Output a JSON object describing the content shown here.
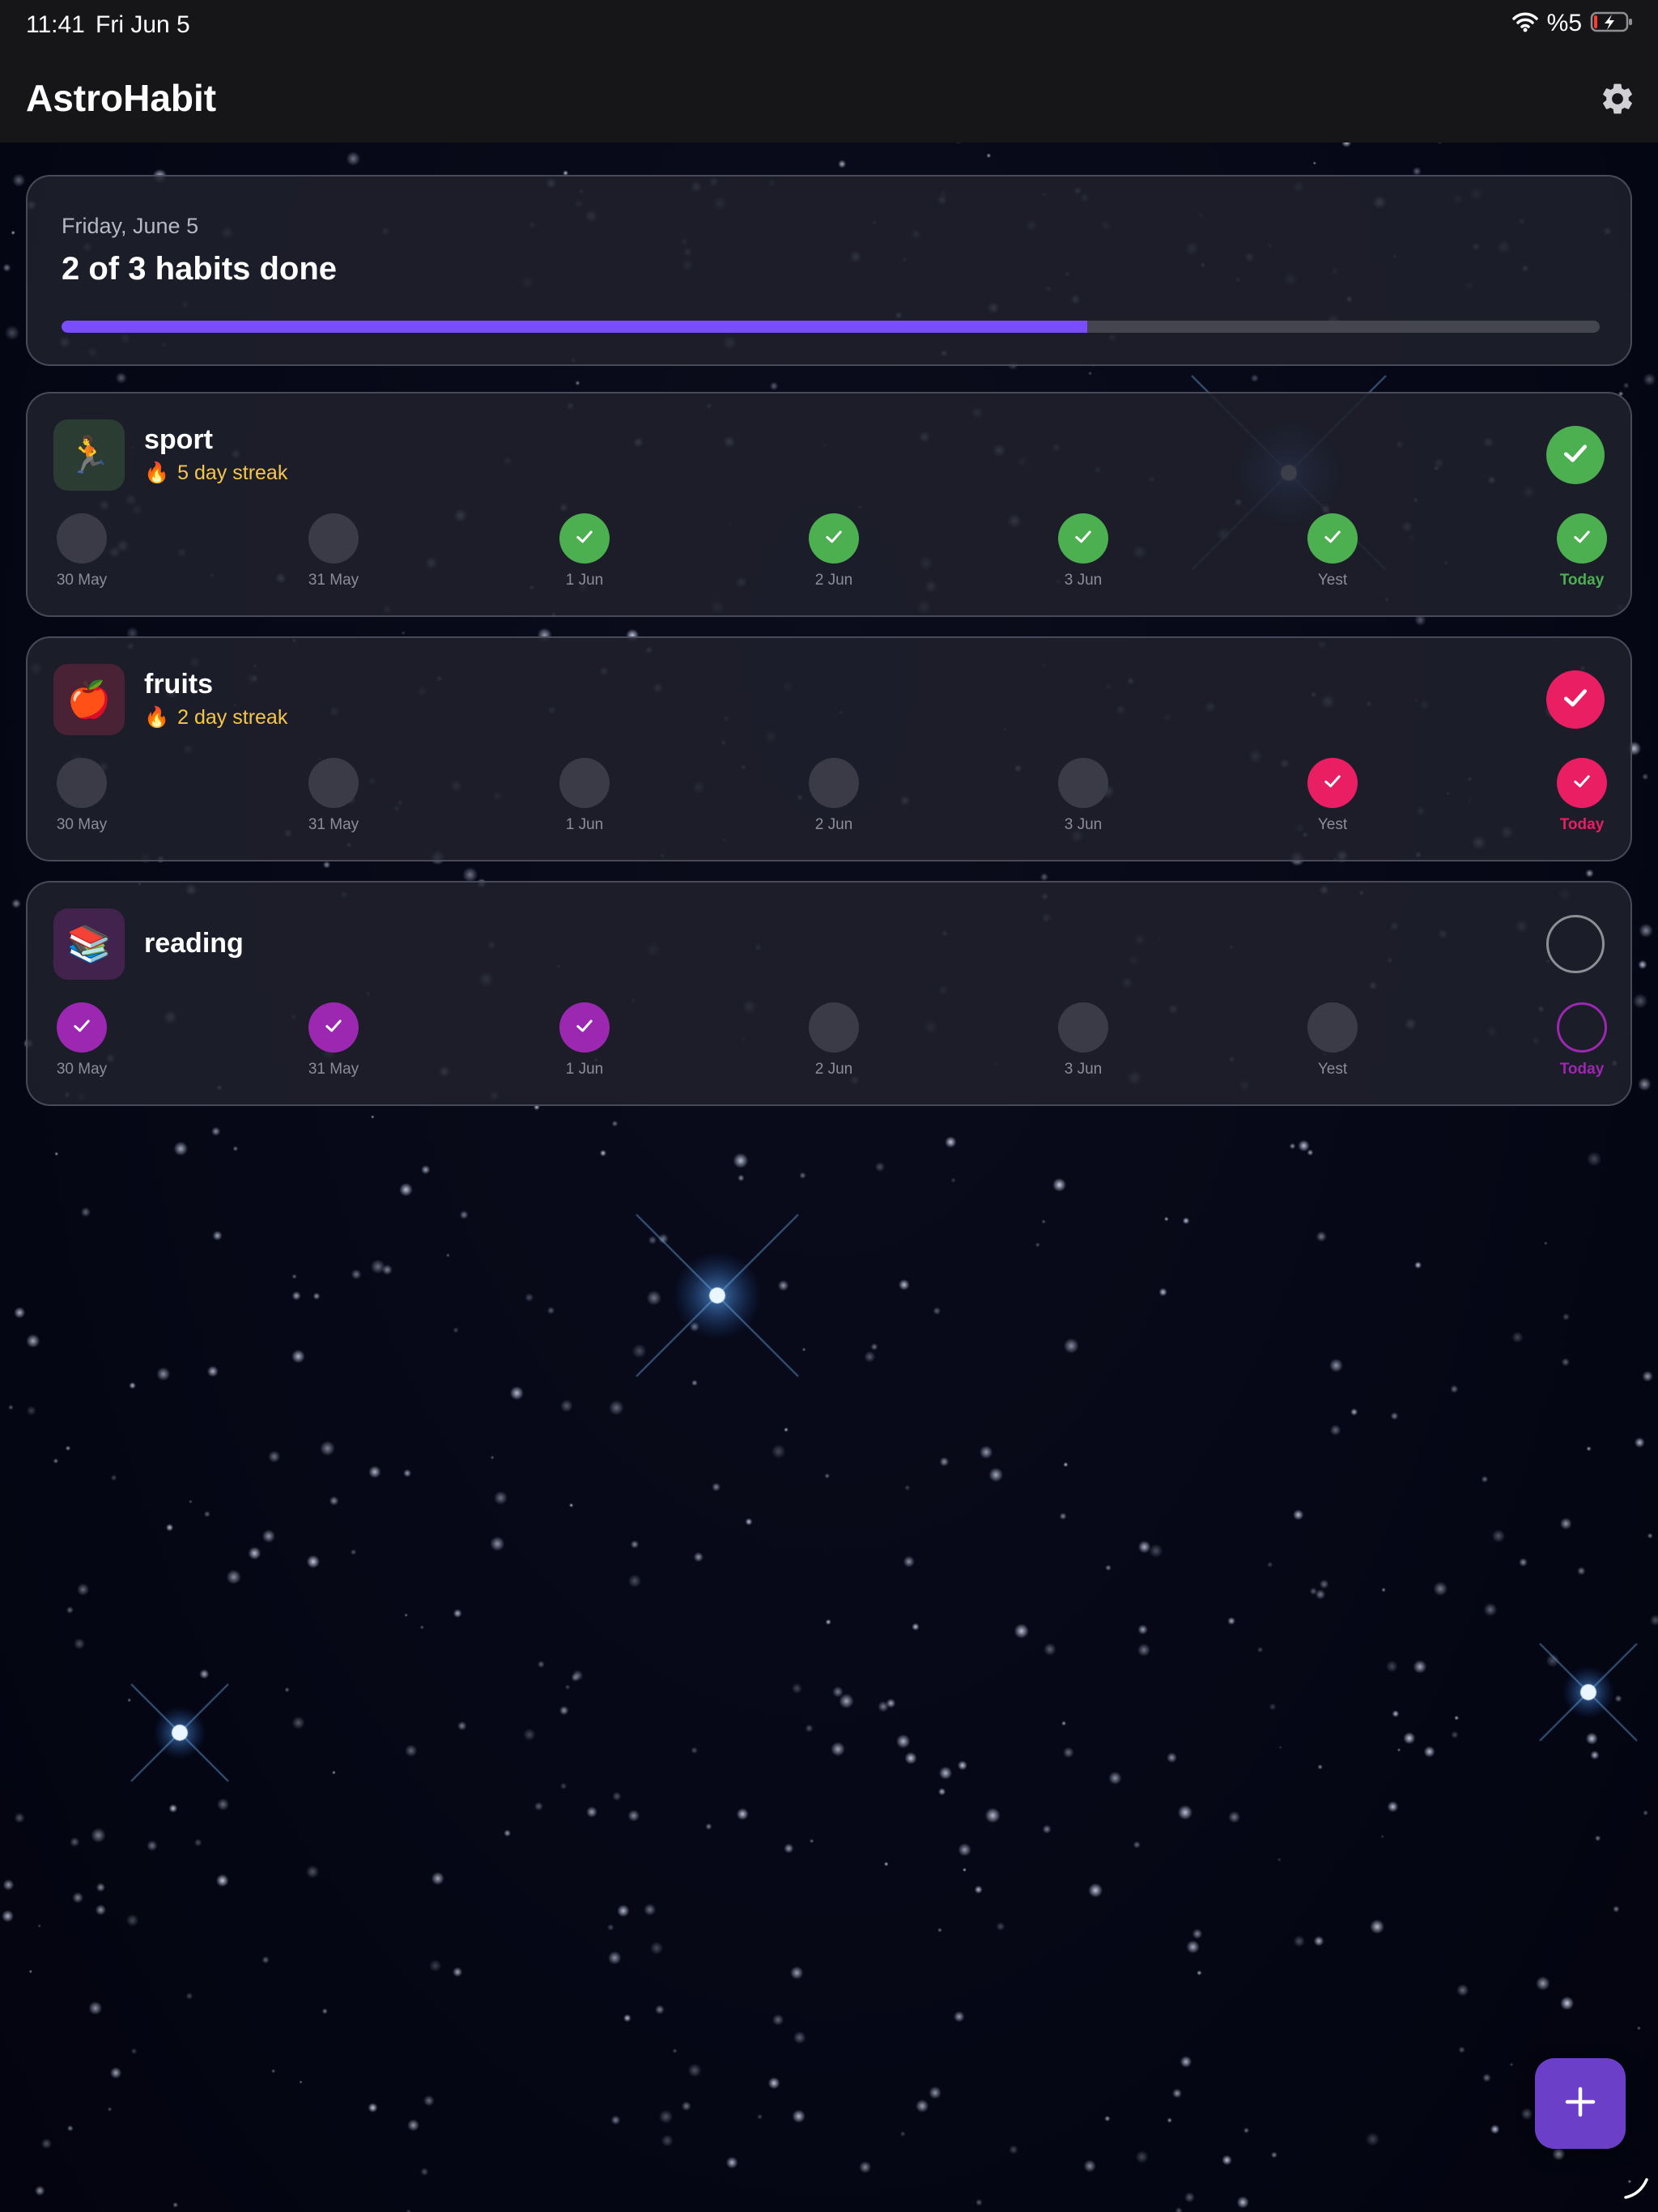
{
  "status_bar": {
    "time": "11:41",
    "date": "Fri Jun 5",
    "battery_text": "%5",
    "icons": [
      "wifi-icon",
      "battery-charging-icon"
    ]
  },
  "header": {
    "title": "AstroHabit",
    "settings_icon": "gear-icon"
  },
  "summary": {
    "date": "Friday, June 5",
    "done_text": "2 of 3 habits done",
    "progress": 0.667,
    "progress_color": "#7a4dfb"
  },
  "habits": [
    {
      "name": "sport",
      "icon": "🏃",
      "icon_bg": "#2b3c33",
      "streak": "5 day streak",
      "color": "#4caf50",
      "done_today": true,
      "days": [
        {
          "label": "30 May",
          "done": false
        },
        {
          "label": "31 May",
          "done": false
        },
        {
          "label": "1 Jun",
          "done": true
        },
        {
          "label": "2 Jun",
          "done": true
        },
        {
          "label": "3 Jun",
          "done": true
        },
        {
          "label": "Yest",
          "done": true
        },
        {
          "label": "Today",
          "done": true,
          "today": true
        }
      ]
    },
    {
      "name": "fruits",
      "icon": "🍎",
      "icon_bg": "#4a2236",
      "streak": "2 day streak",
      "color": "#e91e63",
      "done_today": true,
      "days": [
        {
          "label": "30 May",
          "done": false
        },
        {
          "label": "31 May",
          "done": false
        },
        {
          "label": "1 Jun",
          "done": false
        },
        {
          "label": "2 Jun",
          "done": false
        },
        {
          "label": "3 Jun",
          "done": false
        },
        {
          "label": "Yest",
          "done": true
        },
        {
          "label": "Today",
          "done": true,
          "today": true
        }
      ]
    },
    {
      "name": "reading",
      "icon": "📚",
      "icon_bg": "#42234e",
      "streak": "",
      "color": "#9c27b0",
      "done_today": false,
      "days": [
        {
          "label": "30 May",
          "done": true
        },
        {
          "label": "31 May",
          "done": true
        },
        {
          "label": "1 Jun",
          "done": true
        },
        {
          "label": "2 Jun",
          "done": false
        },
        {
          "label": "3 Jun",
          "done": false
        },
        {
          "label": "Yest",
          "done": false
        },
        {
          "label": "Today",
          "done": false,
          "today": true
        }
      ]
    }
  ],
  "fab": {
    "icon": "plus-icon",
    "color": "#6c3fc9"
  }
}
